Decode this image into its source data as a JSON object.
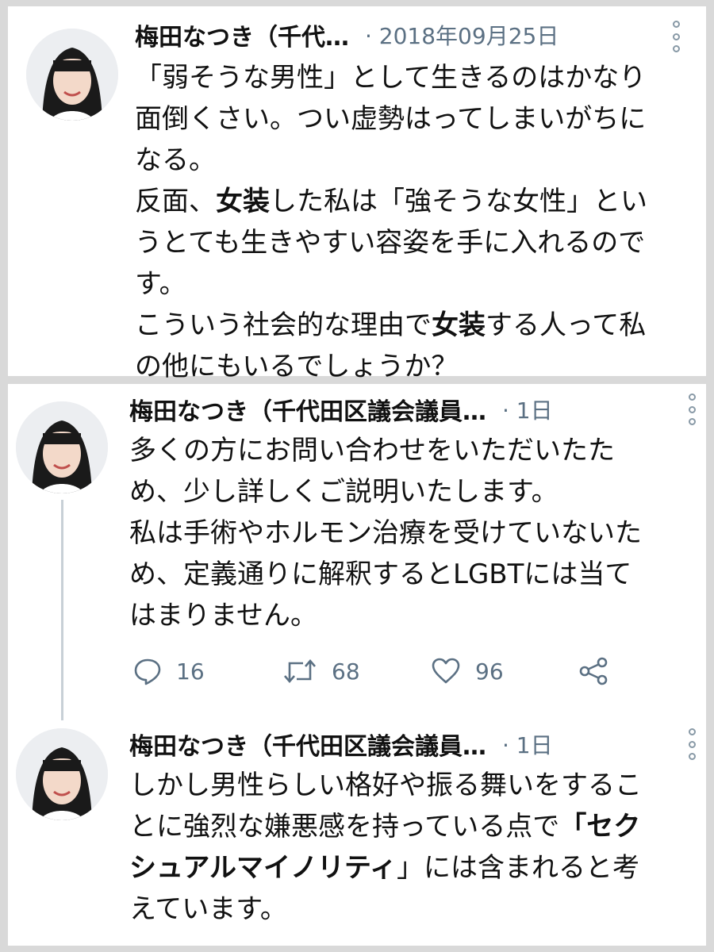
{
  "tweets": [
    {
      "author": "梅田なつき（千代…",
      "meta": "· 2018年09月25日",
      "lines": [
        [
          {
            "t": "「弱そうな男性」として生きるのはかなり"
          }
        ],
        [
          {
            "t": "面倒くさい。つい虚勢はってしまいがちに"
          }
        ],
        [
          {
            "t": "なる。"
          }
        ],
        [
          {
            "t": "反面、"
          },
          {
            "t": "女装",
            "b": true
          },
          {
            "t": "した私は「強そうな女性」とい"
          }
        ],
        [
          {
            "t": "うとても生きやすい容姿を手に入れるので"
          }
        ],
        [
          {
            "t": "す。"
          }
        ],
        [
          {
            "t": "こういう社会的な理由で"
          },
          {
            "t": "女装",
            "b": true
          },
          {
            "t": "する人って私"
          }
        ],
        [
          {
            "t": "の他にもいるでしょうか？"
          }
        ]
      ]
    },
    {
      "author": "梅田なつき（千代田区議会議員…",
      "meta": "· 1日",
      "lines": [
        [
          {
            "t": "多くの方にお問い合わせをいただいたた"
          }
        ],
        [
          {
            "t": "め、少し詳しくご説明いたします。"
          }
        ],
        [
          {
            "t": "私は手術やホルモン治療を受けていないた"
          }
        ],
        [
          {
            "t": "め、定義通りに解釈するとLGBTには当て"
          }
        ],
        [
          {
            "t": "はまりません。"
          }
        ]
      ],
      "actions": {
        "reply_count": "16",
        "retweet_count": "68",
        "like_count": "96"
      }
    },
    {
      "author": "梅田なつき（千代田区議会議員…",
      "meta": "· 1日",
      "lines": [
        [
          {
            "t": "しかし男性らしい格好や振る舞いをするこ"
          }
        ],
        [
          {
            "t": "とに強烈な嫌悪感を持っている点で"
          },
          {
            "t": "「セク",
            "b": true
          }
        ],
        [
          {
            "t": "シュアルマイノリティ",
            "b": true
          },
          {
            "t": "」には含まれると考"
          }
        ],
        [
          {
            "t": "えています。"
          }
        ]
      ]
    }
  ],
  "icons": {
    "reply": "reply-icon",
    "retweet": "retweet-icon",
    "like": "heart-icon",
    "share": "share-icon",
    "more": "more-vertical-icon"
  },
  "colors": {
    "meta": "#5b7083",
    "panel_bg": "#ffffff",
    "page_bg": "#d9d9d9",
    "thread_line": "#c8d0d6"
  }
}
